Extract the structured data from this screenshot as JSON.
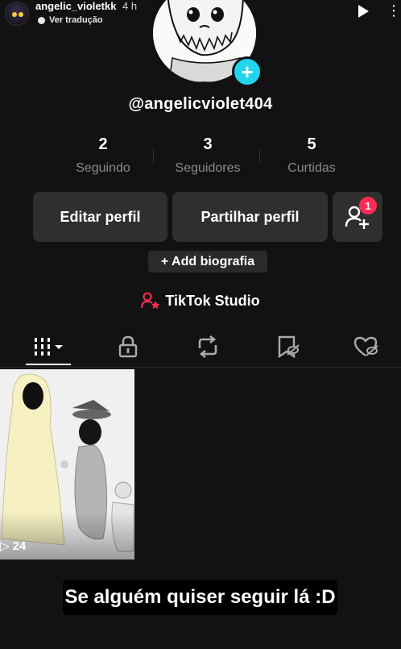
{
  "story": {
    "username": "angelic_violetkk",
    "time_ago": "4 h",
    "translate_label": "Ver tradução",
    "avatar_icon": "avatar-icon",
    "play_icon": "play-icon",
    "more_icon": "more-icon",
    "more_glyph": "⋮"
  },
  "profile": {
    "handle": "@angelicviolet404",
    "add_glyph": "+",
    "accent_color": "#20d5ec"
  },
  "stats": [
    {
      "value": "2",
      "label": "Seguindo"
    },
    {
      "value": "3",
      "label": "Seguidores"
    },
    {
      "value": "5",
      "label": "Curtidas"
    }
  ],
  "actions": {
    "edit_profile": "Editar perfil",
    "share_profile": "Partilhar perfil",
    "add_friend_badge": "1",
    "badge_color": "#fe2c55"
  },
  "bio_button": "+ Add biografia",
  "studio_label": "TikTok Studio",
  "tabs": [
    {
      "name": "videos",
      "icon": "grid-icon",
      "active": true
    },
    {
      "name": "private",
      "icon": "lock-icon",
      "active": false
    },
    {
      "name": "reposts",
      "icon": "repost-icon",
      "active": false
    },
    {
      "name": "favorites",
      "icon": "bookmark-icon",
      "active": false
    },
    {
      "name": "liked",
      "icon": "heart-icon",
      "active": false
    }
  ],
  "videos": [
    {
      "views": "24",
      "play_glyph": "▷"
    }
  ],
  "caption": "Se alguém quiser seguir lá :D"
}
